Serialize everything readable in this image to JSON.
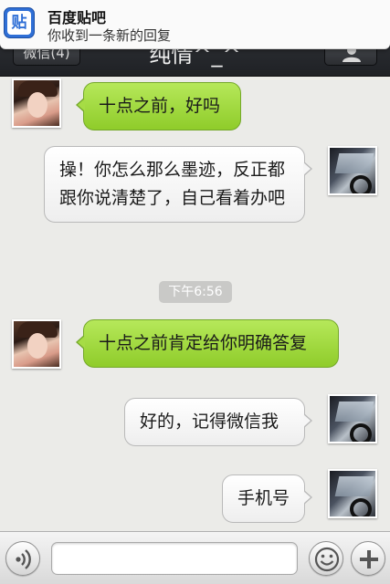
{
  "notification": {
    "app_icon": "tieba-icon",
    "app_icon_glyph": "贴",
    "title": "百度贴吧",
    "text": "你收到一条新的回复"
  },
  "navbar": {
    "back_label": "微信(4)",
    "title": "纯情^_^",
    "profile_icon": "person-icon"
  },
  "messages": [
    {
      "side": "left",
      "text": "十点之前，好吗"
    },
    {
      "side": "right",
      "text": "操！你怎么那么墨迹，反正都跟你说清楚了，自己看着办吧"
    },
    {
      "side": "left",
      "text": "十点之前肯定给你明确答复"
    },
    {
      "side": "right",
      "text": "好的，记得微信我"
    },
    {
      "side": "right",
      "text": "手机号"
    }
  ],
  "timestamp": "下午6:56",
  "inputbar": {
    "voice_icon": "voice-icon",
    "emoji_icon": "smiley-icon",
    "add_icon": "plus-icon",
    "input_value": ""
  },
  "colors": {
    "bubble_green": "#9ed43a",
    "bubble_white": "#f6f6f6",
    "navbar": "#2a2c30"
  }
}
